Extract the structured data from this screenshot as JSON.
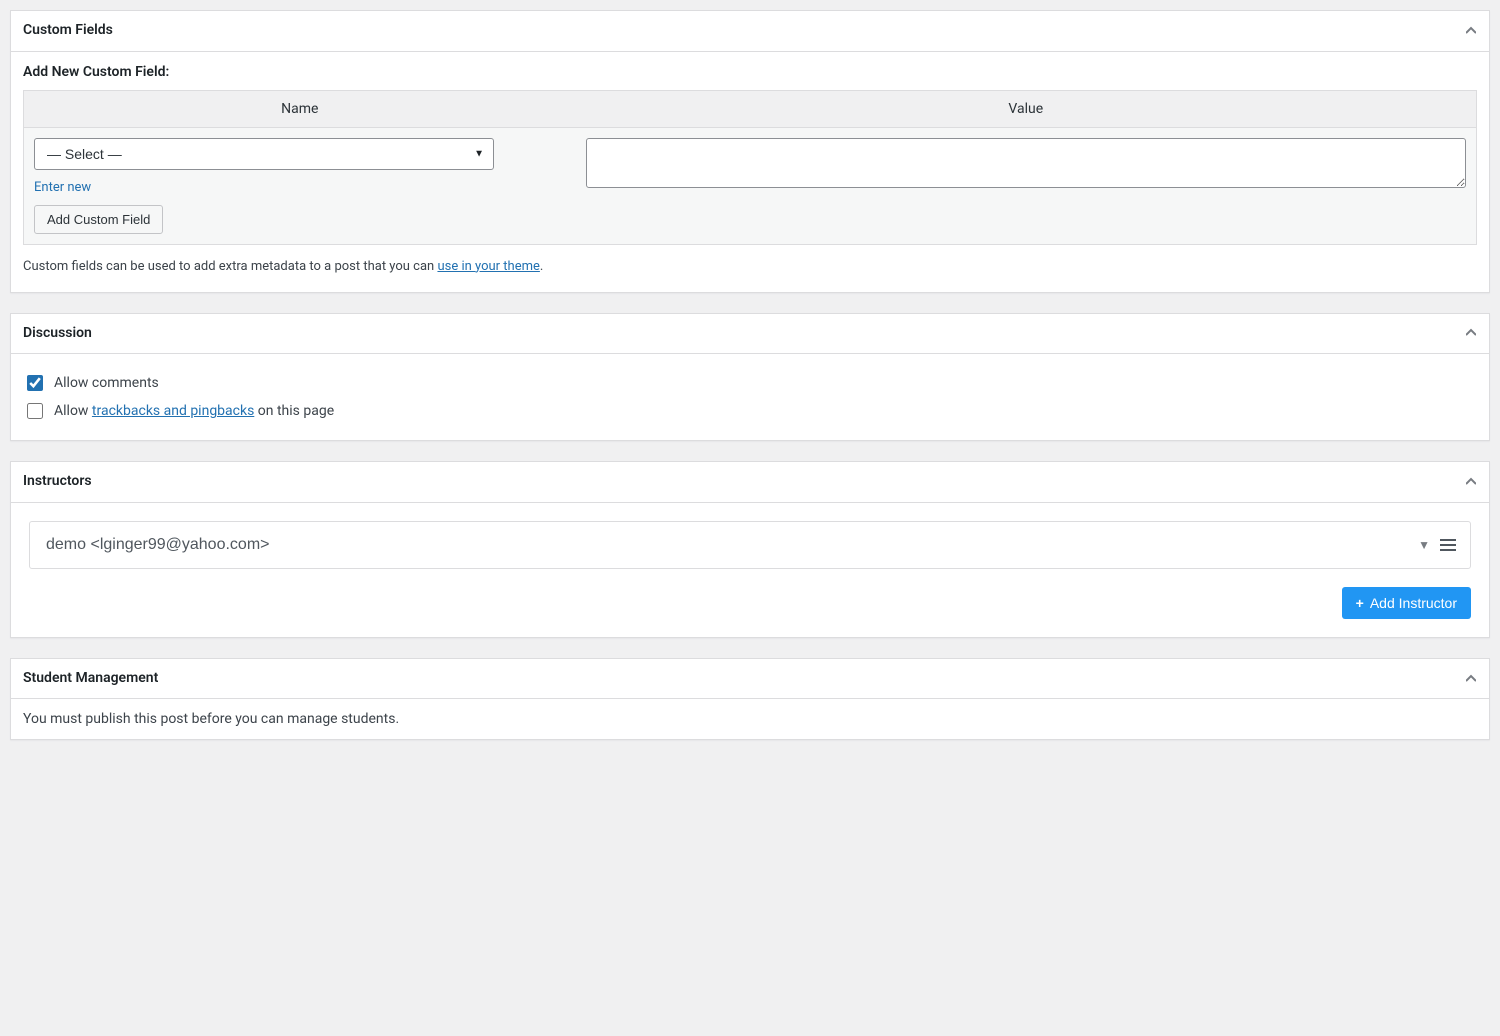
{
  "custom_fields": {
    "title": "Custom Fields",
    "add_new_label": "Add New Custom Field:",
    "columns": {
      "name": "Name",
      "value": "Value"
    },
    "select_placeholder": "— Select —",
    "enter_new": "Enter new",
    "add_button": "Add Custom Field",
    "description_prefix": "Custom fields can be used to add extra metadata to a post that you can ",
    "description_link": "use in your theme",
    "description_suffix": "."
  },
  "discussion": {
    "title": "Discussion",
    "allow_comments": "Allow comments",
    "allow_prefix": "Allow ",
    "trackbacks_link": "trackbacks and pingbacks",
    "allow_suffix": " on this page",
    "comments_checked": true,
    "trackbacks_checked": false
  },
  "instructors": {
    "title": "Instructors",
    "items": [
      {
        "label": "demo <lginger99@yahoo.com>"
      }
    ],
    "add_button": "Add Instructor"
  },
  "student_management": {
    "title": "Student Management",
    "notice": "You must publish this post before you can manage students."
  }
}
